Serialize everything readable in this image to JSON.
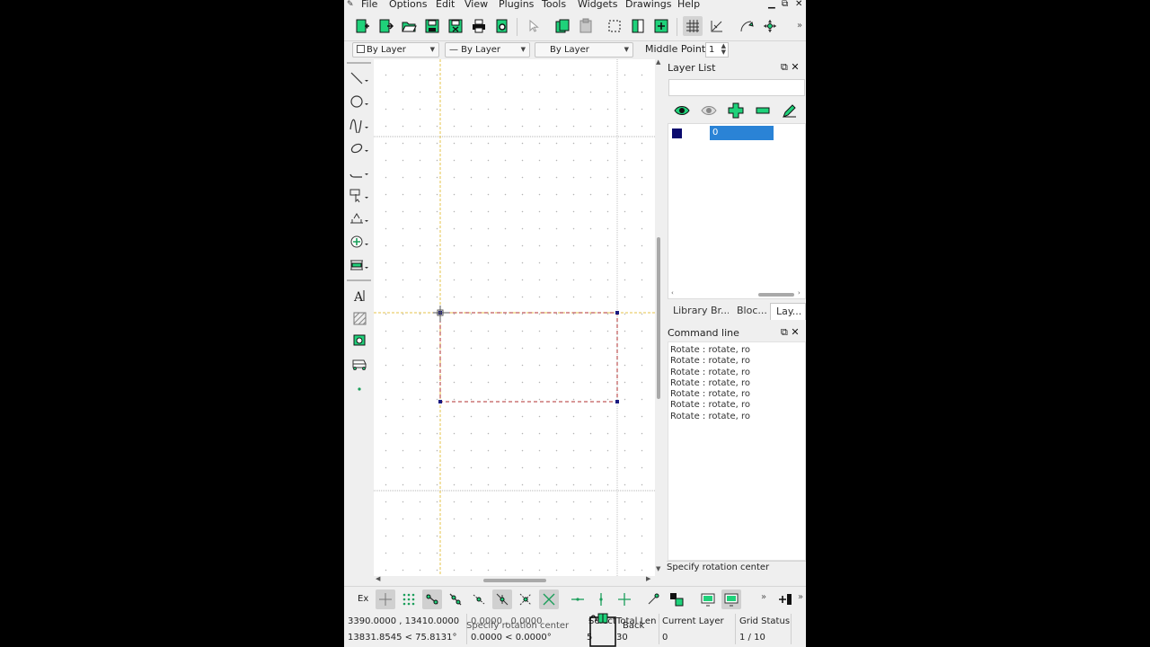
{
  "menu": {
    "items": [
      "File",
      "Options",
      "Edit",
      "View",
      "Plugins",
      "Tools",
      "Widgets",
      "Drawings",
      "Help"
    ],
    "window_buttons": [
      "minimize",
      "restore",
      "close"
    ]
  },
  "toolbar": {
    "icons": [
      "new-icon",
      "new-template-icon",
      "open-icon",
      "save-icon",
      "save-as-icon",
      "print-icon",
      "print-preview-icon",
      "select-pointer-icon",
      "copy-icon",
      "paste-icon",
      "select-window-icon",
      "undo-icon",
      "redo-icon",
      "grid-icon",
      "draft-icon",
      "ortho-icon",
      "move-icon"
    ],
    "overflow": "»"
  },
  "pen_toolbar": {
    "color": "By Layer",
    "line_type": "— By Layer",
    "line_width": "By Layer",
    "middle_points_label": "Middle Points",
    "middle_points_value": "1"
  },
  "left_tools": [
    "line-tool-icon",
    "circle-tool-icon",
    "curve-tool-icon",
    "ellipse-tool-icon",
    "polyline-tool-icon",
    "select-tool-icon",
    "dimension-tool-icon",
    "modify-tool-icon",
    "measure-tool-icon",
    "text-tool-icon",
    "hatch-tool-icon",
    "image-tool-icon",
    "block-tool-icon",
    "point-tool-icon"
  ],
  "layer_dock": {
    "title": "Layer List",
    "layers": [
      {
        "name": "0",
        "color": "#0a0a6e"
      }
    ]
  },
  "dock_tabs": [
    "Library Br...",
    "Bloc...",
    "Lay..."
  ],
  "command_dock": {
    "title": "Command line",
    "history": [
      "Rotate : rotate, ro",
      "Rotate : rotate, ro",
      "Rotate : rotate, ro",
      "Rotate : rotate, ro",
      "Rotate : rotate, ro",
      "Rotate : rotate, ro",
      "Rotate : rotate, ro"
    ],
    "prompt": "Specify rotation center"
  },
  "snap_toolbar": {
    "label": "Ex",
    "overflow": "»"
  },
  "status": {
    "abs_coord": "3390.0000 , 13410.0000",
    "abs_polar": "13831.8545 < 75.8131°",
    "rel_coord": "0.0000 , 0.0000",
    "rel_polar": "0.0000 < 0.0000°",
    "prompt": "Specify rotation center",
    "selected_label": "Select",
    "back_label": "Back",
    "total_length_label": "Total Len",
    "selected_count": "5",
    "total_length_value": "30",
    "current_layer_label": "Current Layer",
    "current_layer_value": "0",
    "grid_status_label": "Grid Status",
    "grid_status_value": "1 / 10"
  },
  "colors": {
    "accent_green": "#1fd17a",
    "selection_blue": "#2a83d6",
    "crosshair_yellow": "#e6c34a",
    "selection_red": "#b03030"
  }
}
